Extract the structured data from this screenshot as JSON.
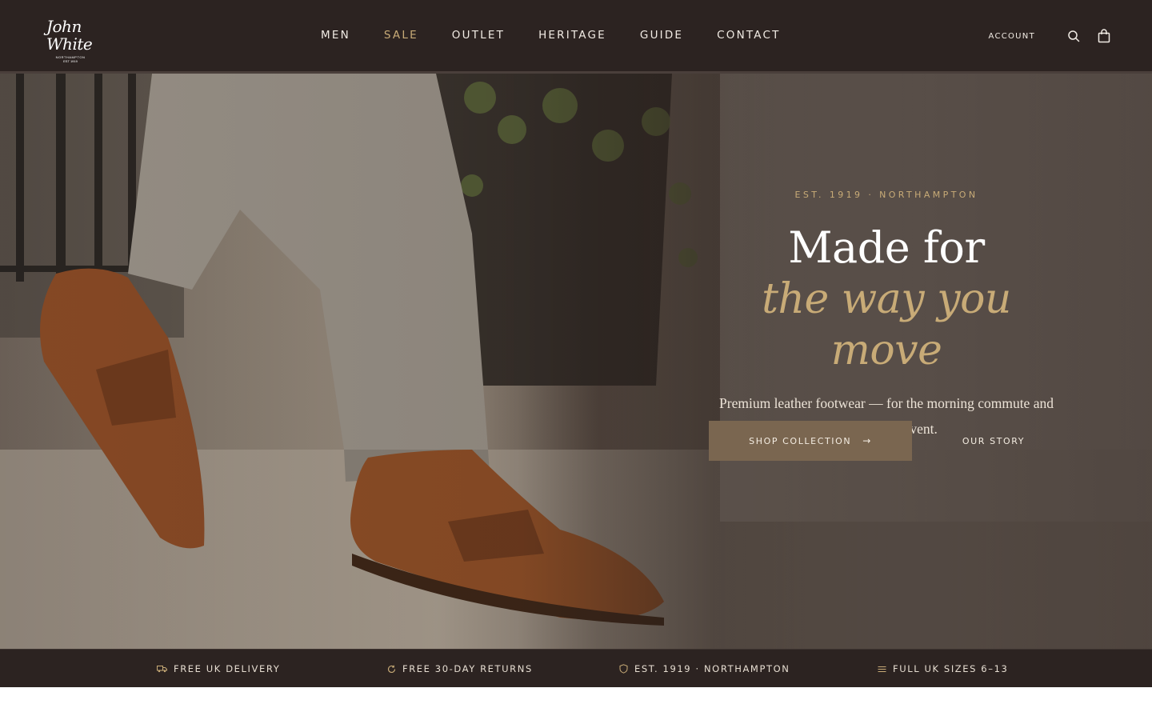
{
  "brand": {
    "name": "John White",
    "sub": "NORTHAMPTON",
    "est": "EST 1919"
  },
  "nav": {
    "items": [
      {
        "label": "MEN"
      },
      {
        "label": "SALE"
      },
      {
        "label": "OUTLET"
      },
      {
        "label": "HERITAGE"
      },
      {
        "label": "GUIDE"
      },
      {
        "label": "CONTACT"
      }
    ],
    "account_label": "ACCOUNT"
  },
  "hero": {
    "eyebrow": "EST. 1919 · NORTHAMPTON",
    "title_line1": "Made for",
    "title_line2": "the way you move",
    "subtitle_line1": "Premium leather footwear — for the morning commute and",
    "subtitle_line2": "the evening event.",
    "primary_cta": "SHOP COLLECTION",
    "primary_cta_arrow": "→",
    "secondary_cta": "OUR STORY"
  },
  "features": [
    {
      "label": "FREE UK DELIVERY",
      "icon": "truck-icon"
    },
    {
      "label": "FREE 30-DAY RETURNS",
      "icon": "refresh-icon"
    },
    {
      "label": "EST. 1919 · NORTHAMPTON",
      "icon": "shield-icon"
    },
    {
      "label": "FULL UK SIZES 6–13",
      "icon": "ruler-icon"
    }
  ],
  "colors": {
    "header_bg": "#2c2321",
    "accent_gold": "#c8ab77",
    "button_bg": "#7a6650",
    "text_light": "#f1ebe4"
  }
}
